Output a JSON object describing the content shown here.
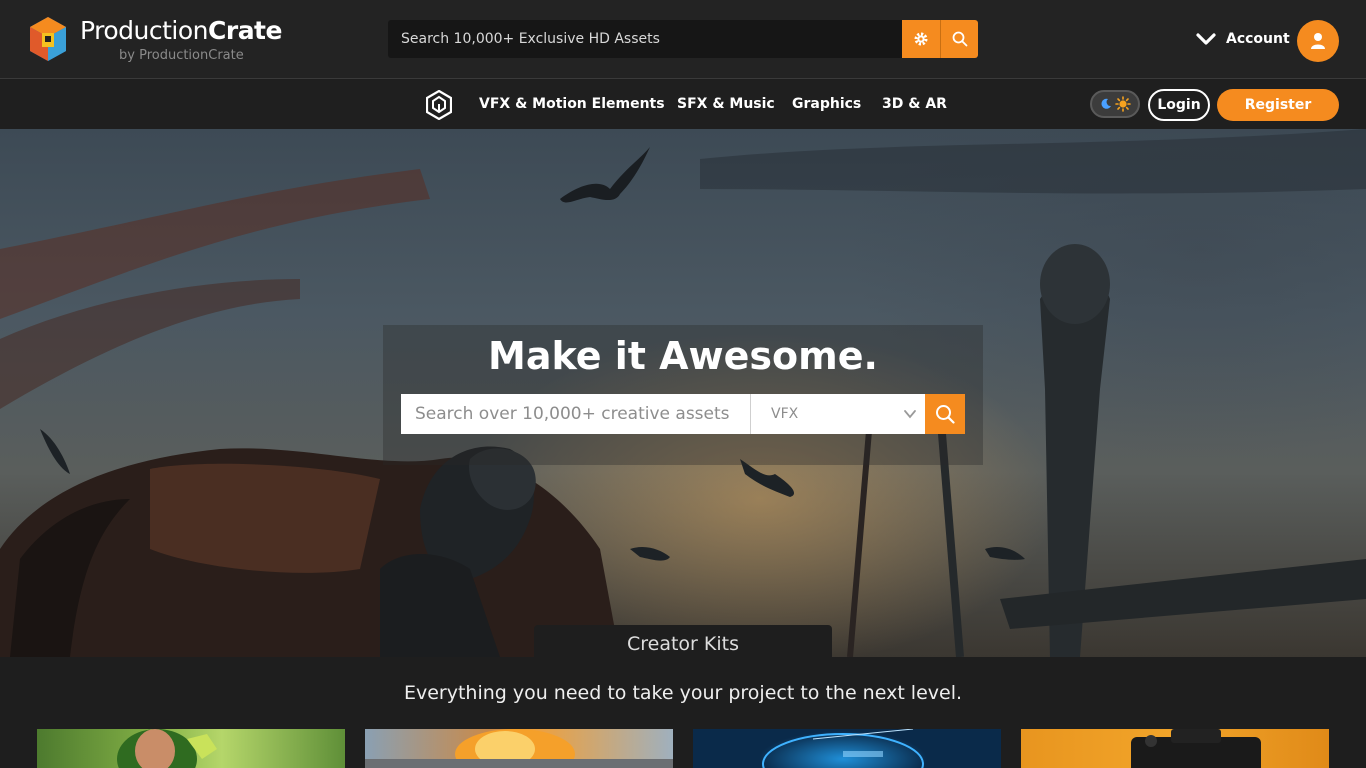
{
  "header": {
    "brand_regular": "Production",
    "brand_bold": "Crate",
    "brand_sub": "by ProductionCrate",
    "search_placeholder": "Search 10,000+ Exclusive HD Assets",
    "account_label": "Account"
  },
  "nav": {
    "items": [
      {
        "label": "VFX & Motion Elements"
      },
      {
        "label": "SFX & Music"
      },
      {
        "label": "Graphics"
      },
      {
        "label": "3D & AR"
      }
    ],
    "login_label": "Login",
    "register_label": "Register"
  },
  "hero": {
    "title": "Make it Awesome.",
    "search_placeholder": "Search over 10,000+ creative assets",
    "category_selected": "VFX",
    "tab_label": "Creator Kits"
  },
  "section": {
    "tagline": "Everything you need to take your project to the next level."
  },
  "icons": {
    "logo": "productioncrate-cube-logo",
    "gear": "gear-icon",
    "search": "search-icon",
    "chevron": "chevron-down-icon",
    "user": "user-icon",
    "theme": "moon-sun-toggle"
  },
  "colors": {
    "accent": "#f58b1f",
    "topbar_bg": "#232323",
    "page_bg": "#1e1e1e"
  }
}
